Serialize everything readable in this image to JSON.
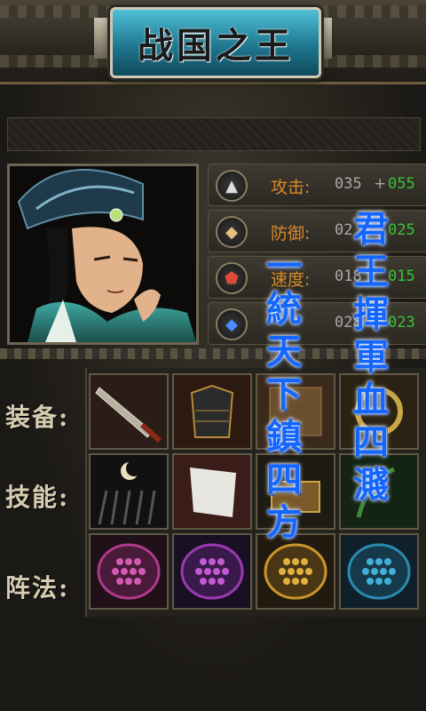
{
  "title": "战国之王",
  "stats": [
    {
      "icon": "spear-icon",
      "label": "攻击:",
      "base": "035",
      "plus": "+",
      "bonus": "055"
    },
    {
      "icon": "shield-icon",
      "label": "防御:",
      "base": "02",
      "plus": "",
      "bonus": "025"
    },
    {
      "icon": "boot-icon",
      "label": "速度:",
      "base": "018",
      "plus": "",
      "bonus": "015"
    },
    {
      "icon": "crystal-icon",
      "label": "",
      "base": "028",
      "plus": "+",
      "bonus": "023"
    }
  ],
  "rows": {
    "equipment": "装备:",
    "skills": "技能:",
    "formation": "阵法:"
  },
  "slogans": {
    "left": [
      "一",
      "統",
      "天",
      "下",
      "鎮",
      "四",
      "方"
    ],
    "right": [
      "君",
      "王",
      "揮",
      "軍",
      "血",
      "四",
      "濺"
    ]
  },
  "slots": {
    "equipment": [
      "sword-icon",
      "armor-icon",
      "scroll-icon",
      "ring-icon"
    ],
    "skills": [
      "moon-arrows-icon",
      "flag-icon",
      "treasure-chest-icon",
      "nature-icon"
    ],
    "formation": [
      "formation-red-icon",
      "formation-purple-icon",
      "formation-gold-icon",
      "formation-teal-icon"
    ]
  },
  "colors": {
    "accent": "#1466ff",
    "stat_label": "#d98a2a",
    "stat_bonus": "#39c23a",
    "title_plaque": "#1f7890"
  }
}
